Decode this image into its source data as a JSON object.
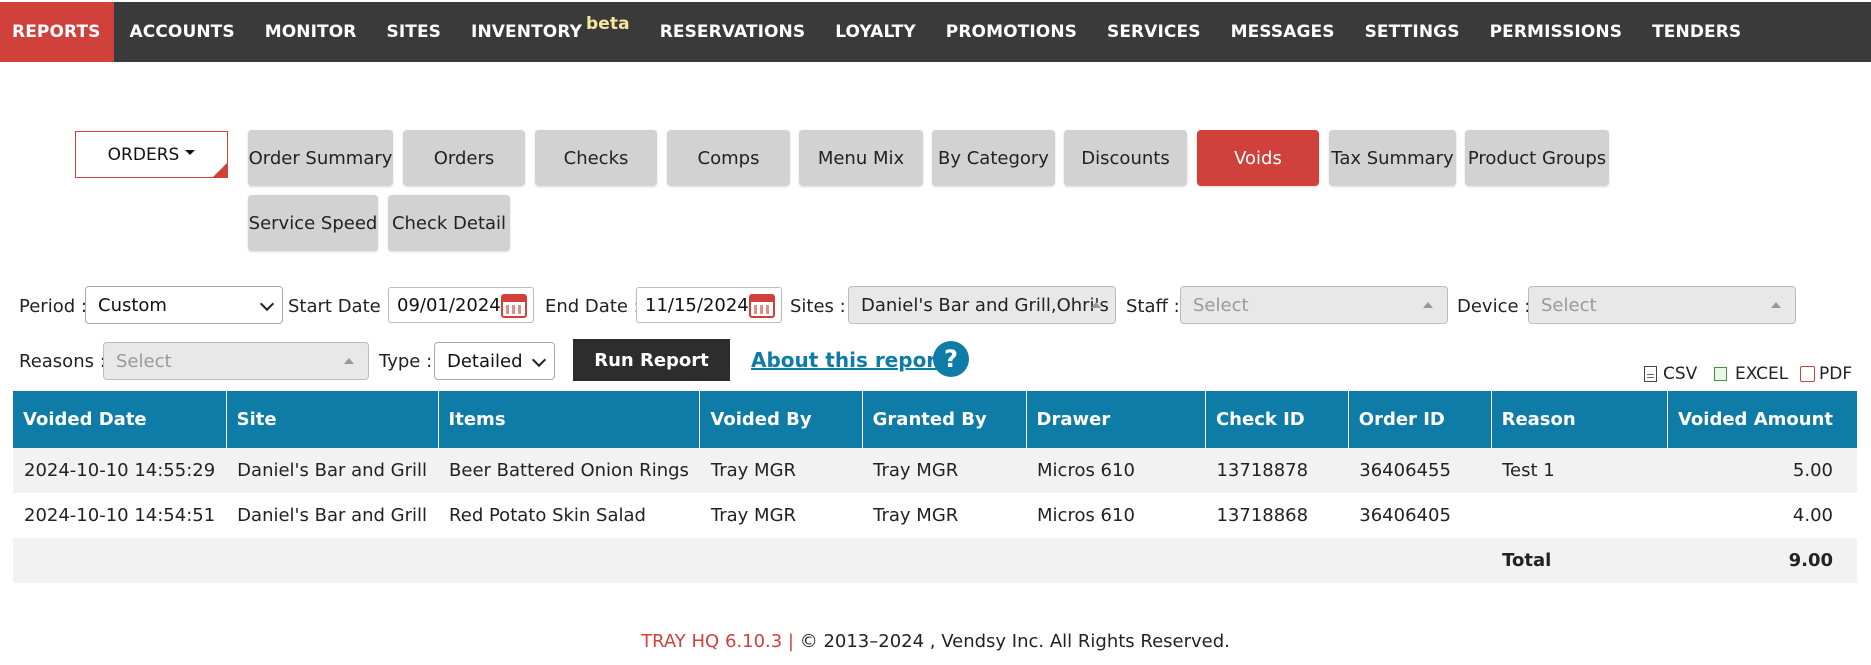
{
  "nav": {
    "items": [
      {
        "label": "REPORTS",
        "active": true
      },
      {
        "label": "ACCOUNTS"
      },
      {
        "label": "MONITOR"
      },
      {
        "label": "SITES"
      },
      {
        "label": "INVENTORY",
        "badge": "beta"
      },
      {
        "label": "RESERVATIONS"
      },
      {
        "label": "LOYALTY"
      },
      {
        "label": "PROMOTIONS"
      },
      {
        "label": "SERVICES"
      },
      {
        "label": "MESSAGES"
      },
      {
        "label": "SETTINGS"
      },
      {
        "label": "PERMISSIONS"
      },
      {
        "label": "TENDERS"
      }
    ]
  },
  "report_group": {
    "label": "ORDERS"
  },
  "tabs": [
    {
      "label": "Order Summary"
    },
    {
      "label": "Orders"
    },
    {
      "label": "Checks"
    },
    {
      "label": "Comps"
    },
    {
      "label": "Menu Mix"
    },
    {
      "label": "By Category"
    },
    {
      "label": "Discounts"
    },
    {
      "label": "Voids",
      "active": true
    },
    {
      "label": "Tax Summary"
    },
    {
      "label": "Product Groups"
    },
    {
      "label": "Service Speed"
    },
    {
      "label": "Check Detail"
    }
  ],
  "filters": {
    "period_label": "Period :",
    "period_value": "Custom",
    "start_label": "Start Date :",
    "start_value": "09/01/2024",
    "end_label": "End Date :",
    "end_value": "11/15/2024",
    "sites_label": "Sites :",
    "sites_value": "Daniel's Bar and Grill,Ohri's",
    "staff_label": "Staff :",
    "staff_placeholder": "Select",
    "device_label": "Device :",
    "device_placeholder": "Select",
    "reasons_label": "Reasons :",
    "reasons_placeholder": "Select",
    "type_label": "Type :",
    "type_value": "Detailed"
  },
  "actions": {
    "run_label": "Run Report",
    "about_label": "About this report",
    "help_label": "?"
  },
  "exports": {
    "csv": "CSV",
    "excel": "EXCEL",
    "pdf": "PDF"
  },
  "table": {
    "headers": [
      "Voided Date",
      "Site",
      "Items",
      "Voided By",
      "Granted By",
      "Drawer",
      "Check ID",
      "Order ID",
      "Reason",
      "Voided Amount"
    ],
    "rows": [
      [
        "2024-10-10 14:55:29",
        "Daniel's Bar and Grill",
        "Beer Battered Onion Rings",
        "Tray MGR",
        "Tray MGR",
        "Micros 610",
        "13718878",
        "36406455",
        "Test 1",
        "5.00"
      ],
      [
        "2024-10-10 14:54:51",
        "Daniel's Bar and Grill",
        "Red Potato Skin Salad",
        "Tray MGR",
        "Tray MGR",
        "Micros 610",
        "13718868",
        "36406405",
        "",
        "4.00"
      ]
    ],
    "total_label": "Total",
    "total_value": "9.00"
  },
  "footer": {
    "version": "TRAY HQ 6.10.3 |",
    "copyright": "© 2013–2024 , Vendsy Inc. All Rights Reserved."
  },
  "colors": {
    "accent": "#d0413c",
    "header_blue": "#0f7ca8",
    "nav_bg": "#3a3a3a"
  }
}
